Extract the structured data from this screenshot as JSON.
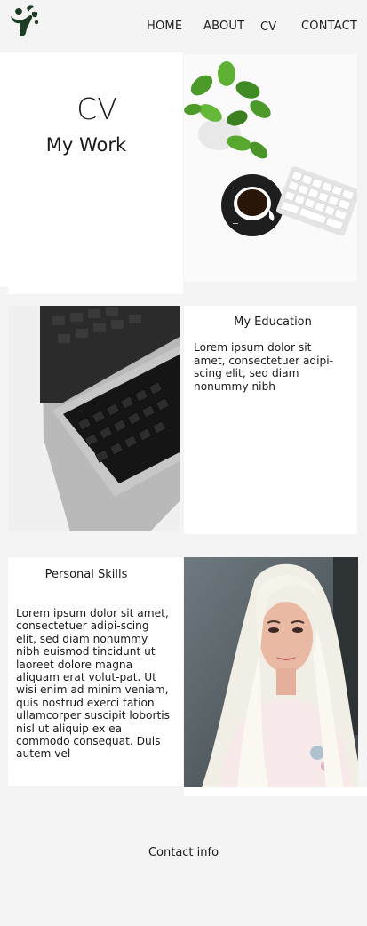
{
  "brand": {
    "logo_icon": "dancing-figure-logo",
    "color": "#1f3d26"
  },
  "nav": {
    "items": [
      {
        "label": "HOME"
      },
      {
        "label": "ABOUT"
      },
      {
        "label": "CV"
      },
      {
        "label": "CONTACT"
      }
    ]
  },
  "hero": {
    "title": "CV",
    "subtitle": "My Work",
    "image": "desk-with-plant-coffee-keyboard"
  },
  "education": {
    "title": "My Education",
    "text": "Lorem ipsum dolor sit amet, consectetuer adipi-scing elit, sed diam nonummy nibh",
    "image": "laptop-keyboard"
  },
  "skills": {
    "title": "Personal Skills",
    "text": "Lorem ipsum dolor sit amet, consectetuer adipi-scing elit, sed diam nonummy nibh euismod tincidunt ut laoreet dolore magna aliquam erat volut-pat. Ut wisi enim ad minim veniam, quis nostrud exerci tation ullamcorper suscipit lobortis nisl ut aliquip ex ea commodo consequat. Duis autem vel",
    "image": "portrait-blonde-woman"
  },
  "contact": {
    "label": "Contact info"
  },
  "colors": {
    "page_bg": "#f4f4f4",
    "card_bg": "#ffffff",
    "text": "#1a1a1a"
  }
}
